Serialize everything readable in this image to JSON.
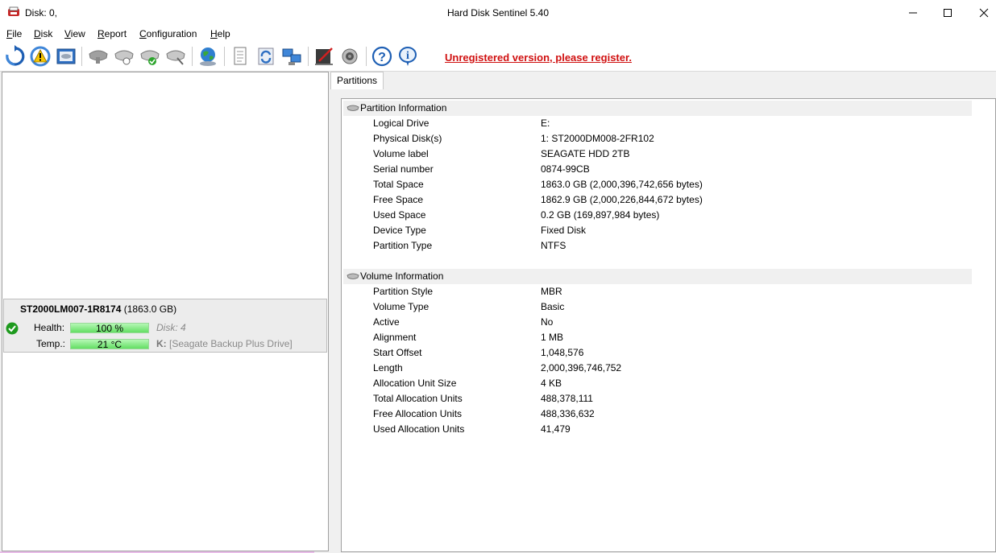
{
  "window": {
    "title_left": "Disk: 0,",
    "title": "Hard Disk Sentinel 5.40"
  },
  "menu": [
    {
      "label": "File",
      "key": "F",
      "rest": "ile"
    },
    {
      "label": "Disk",
      "key": "D",
      "rest": "isk"
    },
    {
      "label": "View",
      "key": "V",
      "rest": "iew"
    },
    {
      "label": "Report",
      "key": "R",
      "rest": "eport"
    },
    {
      "label": "Configuration",
      "key": "C",
      "rest": "onfiguration"
    },
    {
      "label": "Help",
      "key": "H",
      "rest": "elp"
    }
  ],
  "toolbar": {
    "icons": [
      "refresh-icon",
      "alert-icon",
      "disk-view-icon",
      "disk-gray-icon",
      "disk-test-icon",
      "disk-ok-icon",
      "disk-tools-icon",
      "globe-icon",
      "report-icon",
      "update-icon",
      "network-icon",
      "edit-icon",
      "sound-icon",
      "help-icon",
      "info-icon"
    ],
    "register_text": "Unregistered version, please register."
  },
  "disk": {
    "model": "ST2000LM007-1R8174",
    "size": "(1863.0 GB)",
    "health_label": "Health:",
    "health_value": "100 %",
    "health_percent": 100,
    "disk_index": "Disk: 4",
    "temp_label": "Temp.:",
    "temp_value": "21 °C",
    "drive_letter": "K:",
    "drive_name": "[Seagate Backup Plus Drive]"
  },
  "tabs": [
    {
      "label": "Partitions"
    }
  ],
  "partition_info": {
    "heading": "Partition Information",
    "rows": [
      {
        "label": "Logical Drive",
        "value": "E:"
      },
      {
        "label": "Physical Disk(s)",
        "value": "1: ST2000DM008-2FR102"
      },
      {
        "label": "Volume label",
        "value": "SEAGATE HDD 2TB"
      },
      {
        "label": "Serial number",
        "value": "0874-99CB"
      },
      {
        "label": "Total Space",
        "value": "1863.0 GB (2,000,396,742,656 bytes)"
      },
      {
        "label": "Free Space",
        "value": "1862.9 GB (2,000,226,844,672 bytes)"
      },
      {
        "label": "Used Space",
        "value": "0.2 GB (169,897,984 bytes)"
      },
      {
        "label": "Device Type",
        "value": "Fixed Disk"
      },
      {
        "label": "Partition Type",
        "value": "NTFS"
      }
    ]
  },
  "volume_info": {
    "heading": "Volume Information",
    "rows": [
      {
        "label": "Partition Style",
        "value": "MBR"
      },
      {
        "label": "Volume Type",
        "value": "Basic"
      },
      {
        "label": "Active",
        "value": "No"
      },
      {
        "label": "Alignment",
        "value": "1 MB"
      },
      {
        "label": "Start Offset",
        "value": "1,048,576"
      },
      {
        "label": "Length",
        "value": "2,000,396,746,752"
      },
      {
        "label": "Allocation Unit Size",
        "value": "4 KB"
      },
      {
        "label": "Total Allocation Units",
        "value": "488,378,111"
      },
      {
        "label": "Free Allocation Units",
        "value": "488,336,632"
      },
      {
        "label": "Used Allocation Units",
        "value": "41,479"
      }
    ]
  },
  "colors": {
    "register_red": "#d01010",
    "health_green": "#64df64",
    "ok_green": "#1e9a1e"
  }
}
